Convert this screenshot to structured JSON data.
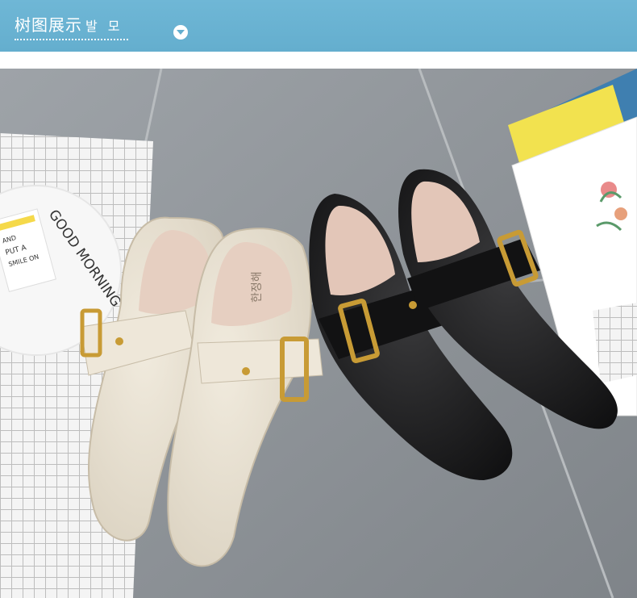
{
  "header": {
    "title": "树图展示",
    "subtitle": "발 모",
    "dropdown_icon": "chevron-down-icon",
    "color": "#64aece"
  },
  "photo": {
    "description_icon": "product-photo",
    "decor": {
      "card_line_1": "AND",
      "card_line_2": "PUT A",
      "card_line_3": "SMILE ON",
      "plate_text": "GOOD MORNING",
      "insole_brand": "한정해"
    }
  }
}
